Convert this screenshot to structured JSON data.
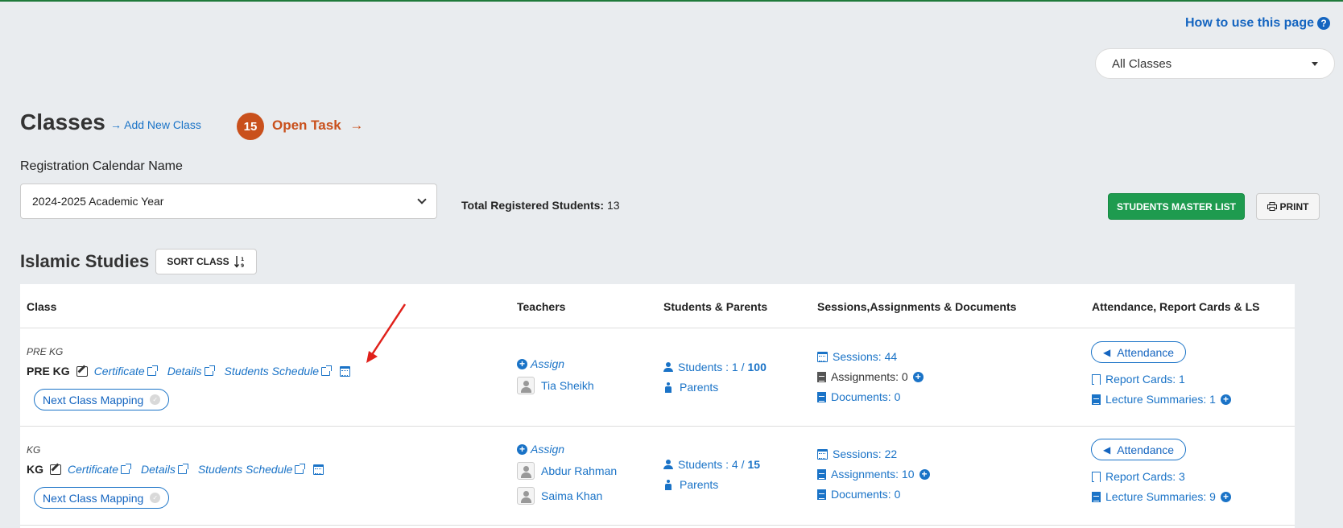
{
  "help": {
    "label": "How to use this page",
    "icon": "question-circle-icon"
  },
  "class_filter": {
    "selected": "All Classes"
  },
  "header": {
    "title": "Classes",
    "add_new_label": "Add New Class",
    "task_count": "15",
    "task_label": "Open Task",
    "arrow": "→"
  },
  "registration": {
    "label": "Registration Calendar Name",
    "selected": "2024-2025 Academic Year",
    "total_label": "Total Registered Students:",
    "total_value": "13"
  },
  "actions": {
    "master_list": "STUDENTS MASTER LIST",
    "print": "PRINT"
  },
  "section": {
    "title": "Islamic Studies",
    "sort_label": "SORT CLASS"
  },
  "table": {
    "headers": [
      "Class",
      "Teachers",
      "Students & Parents",
      "Sessions,Assignments & Documents",
      "Attendance, Report Cards & LS"
    ],
    "rows": [
      {
        "group": "PRE KG",
        "name": "PRE KG",
        "certificate": "Certificate",
        "details": "Details",
        "schedule": "Students Schedule",
        "mapping": "Next Class Mapping",
        "assign": "Assign",
        "teachers": [
          "Tia Sheikh"
        ],
        "students_prefix": "Students : 1 /",
        "students_max": "100",
        "parents": "Parents",
        "sessions": "Sessions: 44",
        "assignments": "Assignments: 0",
        "documents": "Documents: 0",
        "attendance": "Attendance",
        "report_cards": "Report Cards: 1",
        "lecture_summaries": "Lecture Summaries: 1"
      },
      {
        "group": "KG",
        "name": "KG",
        "certificate": "Certificate",
        "details": "Details",
        "schedule": "Students Schedule",
        "mapping": "Next Class Mapping",
        "assign": "Assign",
        "teachers": [
          "Abdur Rahman",
          "Saima Khan"
        ],
        "students_prefix": "Students : 4 /",
        "students_max": "15",
        "parents": "Parents",
        "sessions": "Sessions: 22",
        "assignments": "Assignments: 10",
        "documents": "Documents: 0",
        "attendance": "Attendance",
        "report_cards": "Report Cards: 3",
        "lecture_summaries": "Lecture Summaries: 9"
      }
    ]
  },
  "colors": {
    "accent_blue": "#1a73c7",
    "task_orange": "#c9501c",
    "master_green": "#1e9b4f",
    "annotation_red": "#e0211b"
  }
}
